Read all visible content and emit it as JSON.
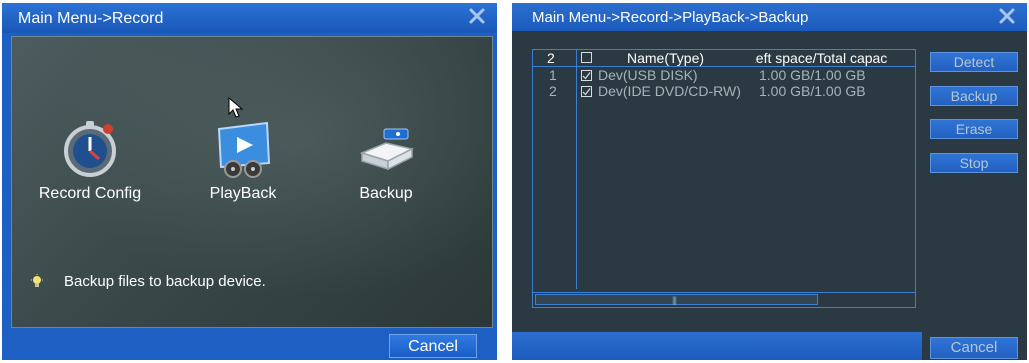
{
  "left_window": {
    "title": "Main Menu->Record",
    "menu": [
      {
        "label": "Record Config",
        "icon": "stopwatch-icon"
      },
      {
        "label": "PlayBack",
        "icon": "film-reel-icon"
      },
      {
        "label": "Backup",
        "icon": "backup-drive-icon"
      }
    ],
    "hint": "Backup files to backup device.",
    "cancel_label": "Cancel"
  },
  "right_window": {
    "title": "Main Menu->Record->PlayBack->Backup",
    "table": {
      "count": "2",
      "headers": {
        "name": "Name(Type)",
        "space": "Left space/Total capac"
      },
      "rows": [
        {
          "index": "1",
          "name": "Dev(USB DISK)",
          "space": "1.00 GB/1.00 GB",
          "checked": true
        },
        {
          "index": "2",
          "name": "Dev(IDE DVD/CD-RW)",
          "space": "1.00 GB/1.00 GB",
          "checked": true
        }
      ]
    },
    "buttons": {
      "detect": "Detect",
      "backup": "Backup",
      "erase": "Erase",
      "stop": "Stop",
      "cancel": "Cancel"
    }
  },
  "colors": {
    "title_blue": "#1d5fc2",
    "panel_dark": "#2b3a42",
    "accent_border": "#3e7fd6"
  }
}
